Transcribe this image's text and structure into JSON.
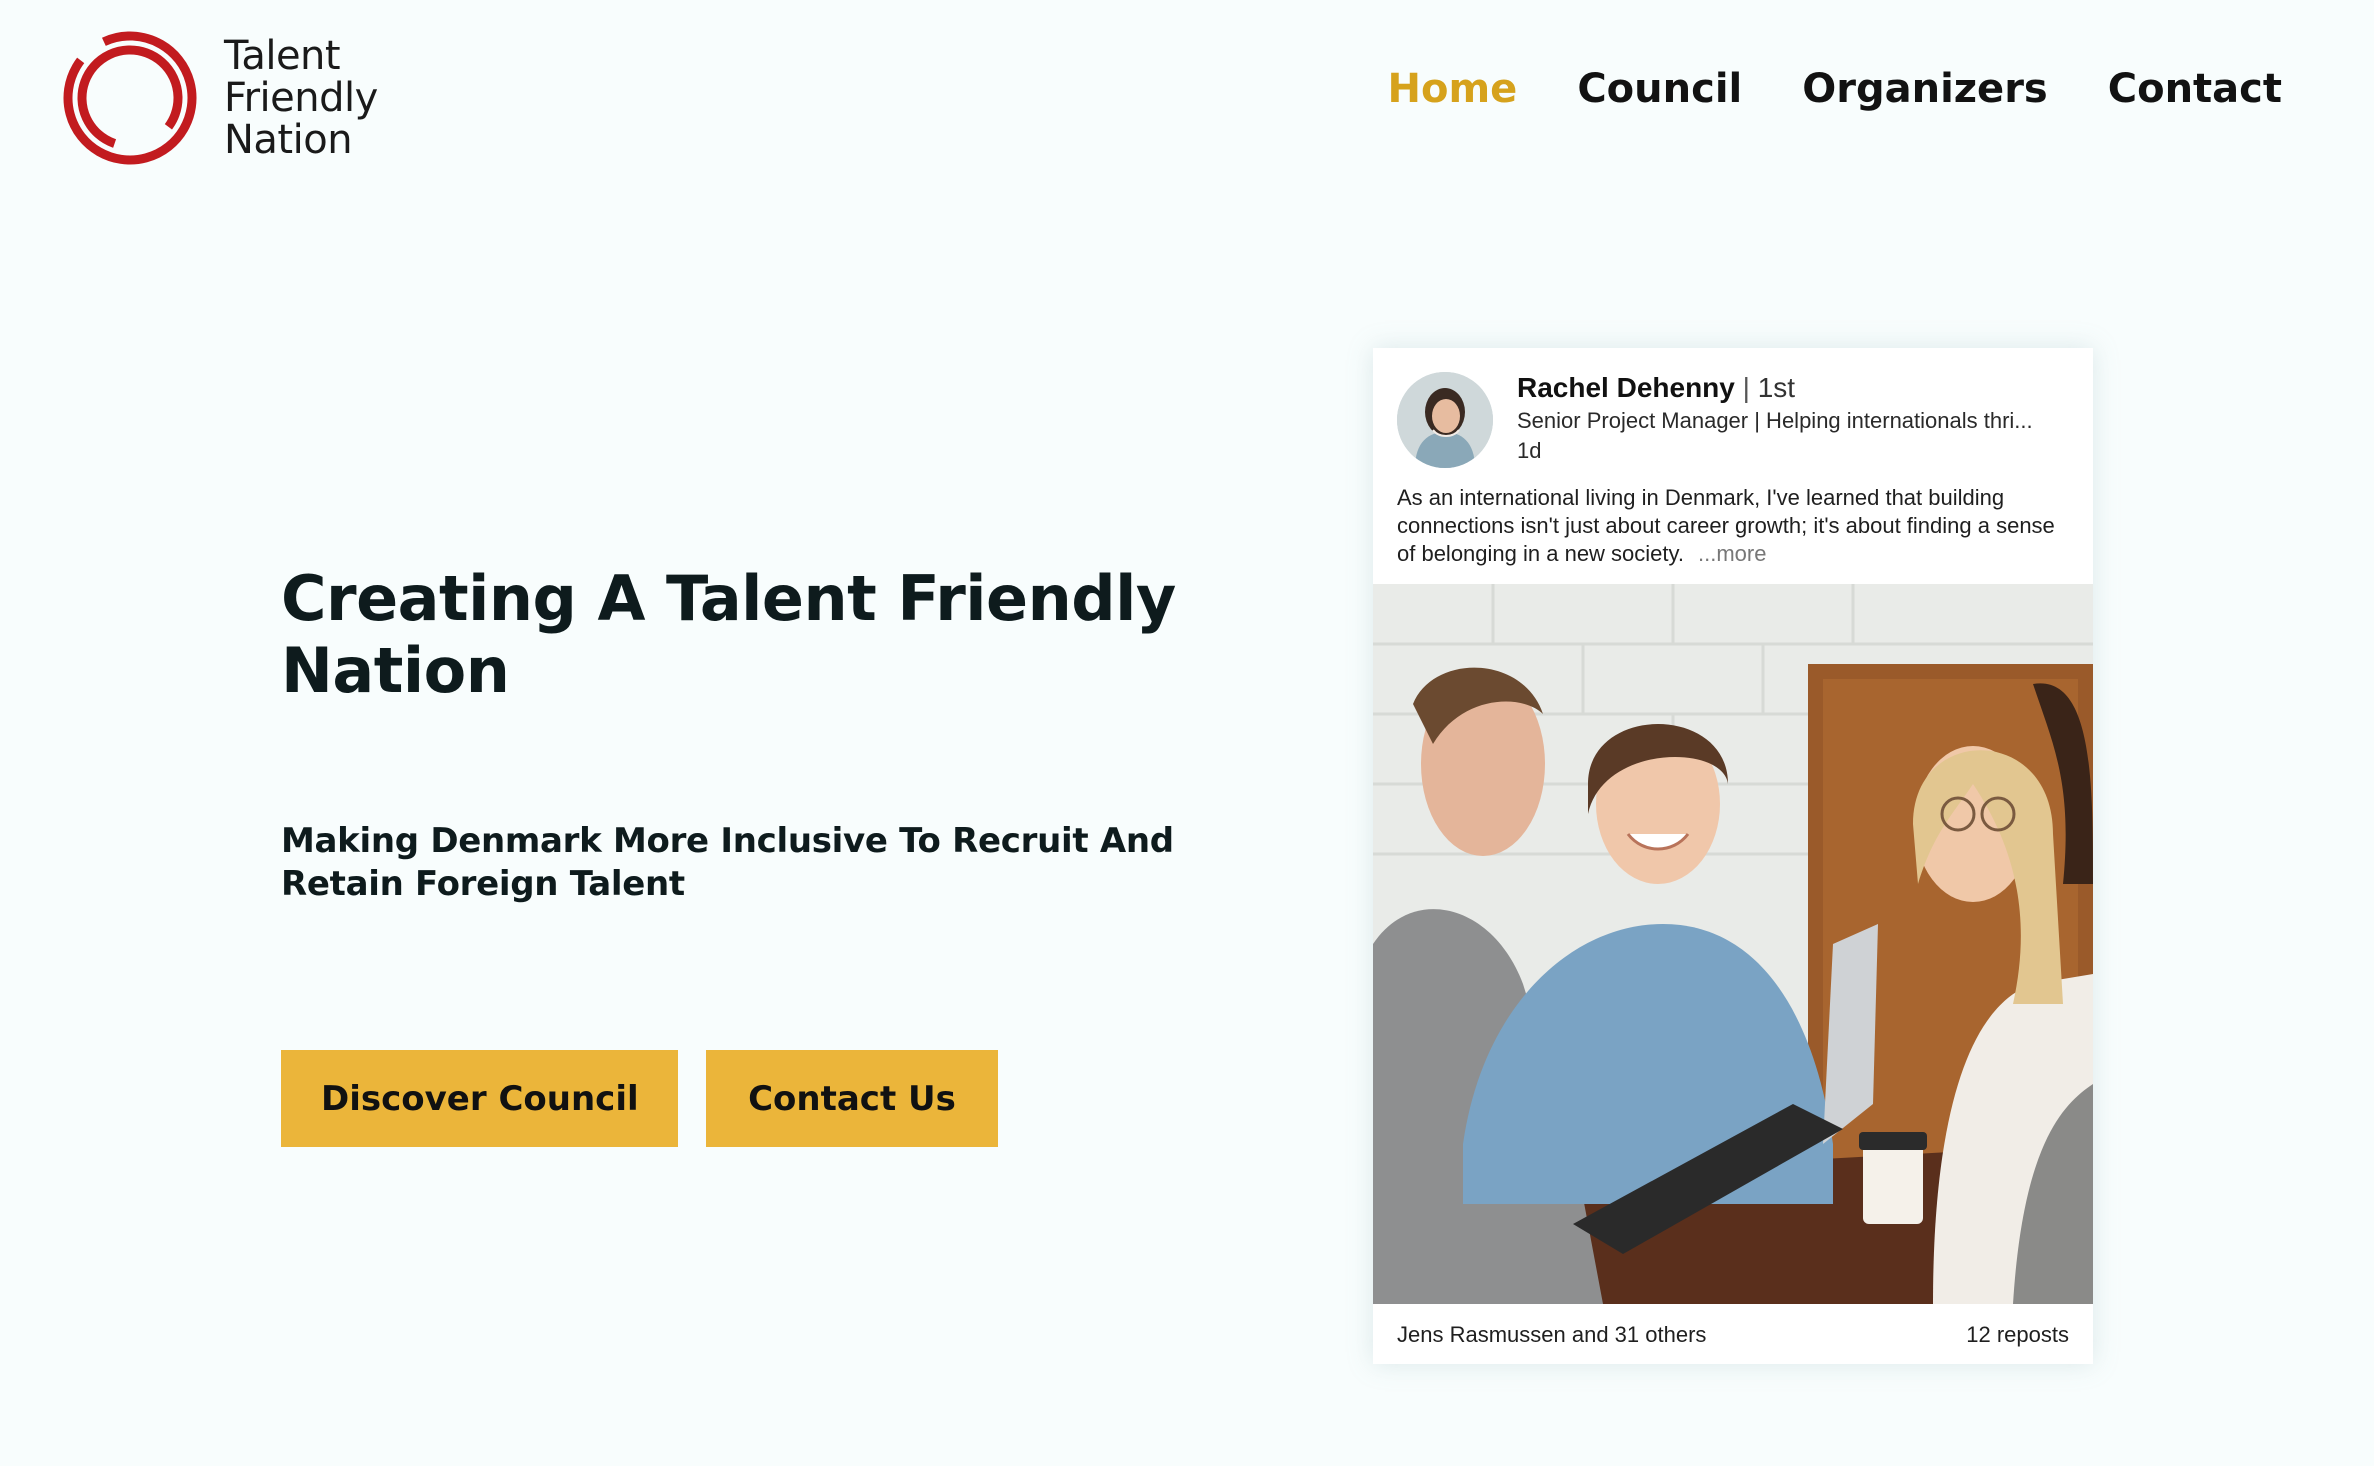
{
  "brand": {
    "logo_lines": [
      "Talent",
      "Friendly",
      "Nation"
    ],
    "logo_color": "#c21b1f"
  },
  "nav": {
    "items": [
      {
        "label": "Home",
        "active": true
      },
      {
        "label": "Council",
        "active": false
      },
      {
        "label": "Organizers",
        "active": false
      },
      {
        "label": "Contact",
        "active": false
      }
    ],
    "active_color": "#d6a21c"
  },
  "hero": {
    "title": "Creating A Talent Friendly Nation",
    "subtitle": "Making Denmark More Inclusive To Recruit And Retain Foreign Talent",
    "buttons": {
      "discover": "Discover Council",
      "contact": "Contact Us"
    },
    "button_color": "#ebb53a"
  },
  "post": {
    "author": "Rachel Dehenny",
    "separator": " | ",
    "degree": "1st",
    "headline": "Senior Project Manager | Helping internationals thri...",
    "time": "1d",
    "text": "As an international living in Denmark, I've learned that building connections isn't just about career growth; it's about finding a sense of belonging in a new society.",
    "more": "...more",
    "reactions": "Jens Rasmussen and 31 others",
    "reposts": "12 reposts"
  }
}
